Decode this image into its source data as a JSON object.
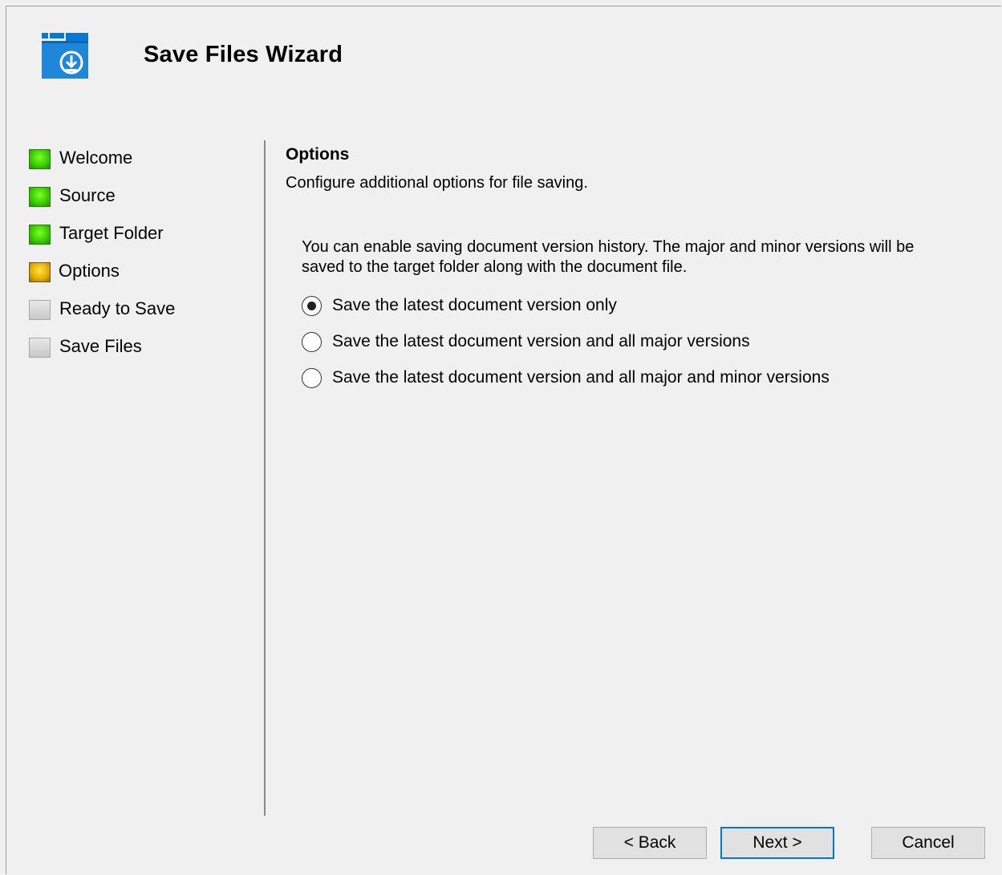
{
  "wizard": {
    "title": "Save Files Wizard",
    "icon": "folder-download-icon",
    "accent_color": "#0078d7"
  },
  "steps": [
    {
      "label": "Welcome",
      "status": "done"
    },
    {
      "label": "Source",
      "status": "done"
    },
    {
      "label": "Target Folder",
      "status": "done"
    },
    {
      "label": "Options",
      "status": "current"
    },
    {
      "label": "Ready to Save",
      "status": "pending"
    },
    {
      "label": "Save Files",
      "status": "pending"
    }
  ],
  "status_colors": {
    "done": "#3fcf00",
    "current": "#e8b000",
    "pending": "#c8c8c8"
  },
  "page": {
    "title": "Options",
    "description": "Configure additional options for file saving.",
    "info": "You can enable saving document version history. The major and minor versions will be saved to the target folder along with the document file.",
    "options": [
      {
        "label": "Save the latest document version only",
        "selected": true
      },
      {
        "label": "Save the latest document version and all major versions",
        "selected": false
      },
      {
        "label": "Save the latest document version and all major and minor versions",
        "selected": false
      }
    ]
  },
  "buttons": {
    "back": "< Back",
    "next": "Next >",
    "cancel": "Cancel"
  }
}
